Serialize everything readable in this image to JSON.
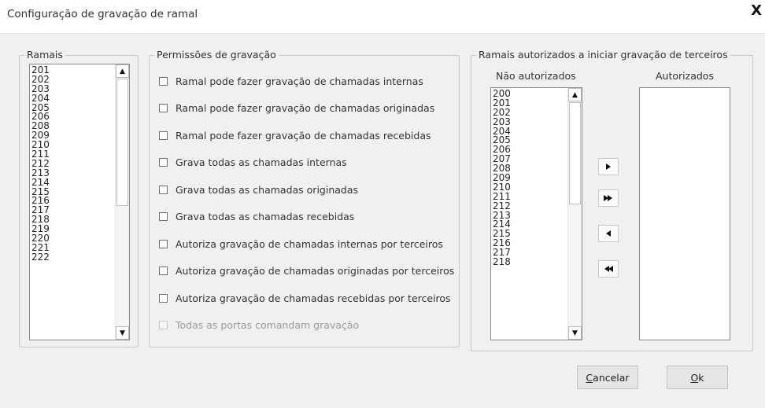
{
  "window": {
    "title": "Configuração de gravação de ramal",
    "close_label": "X"
  },
  "ramais": {
    "legend": "Ramais",
    "items": [
      "201",
      "202",
      "203",
      "204",
      "205",
      "206",
      "208",
      "209",
      "210",
      "211",
      "212",
      "213",
      "214",
      "215",
      "216",
      "217",
      "218",
      "219",
      "220",
      "221",
      "222"
    ]
  },
  "permissoes": {
    "legend": "Permissões de gravação",
    "options": [
      {
        "label": "Ramal pode fazer gravação de chamadas internas",
        "checked": false,
        "enabled": true
      },
      {
        "label": "Ramal pode fazer gravação de chamadas originadas",
        "checked": false,
        "enabled": true
      },
      {
        "label": "Ramal pode fazer gravação de chamadas recebidas",
        "checked": false,
        "enabled": true
      },
      {
        "label": "Grava todas as chamadas internas",
        "checked": false,
        "enabled": true
      },
      {
        "label": "Grava todas as chamadas originadas",
        "checked": false,
        "enabled": true
      },
      {
        "label": "Grava todas as chamadas recebidas",
        "checked": false,
        "enabled": true
      },
      {
        "label": "Autoriza gravação de chamadas internas por terceiros",
        "checked": false,
        "enabled": true
      },
      {
        "label": "Autoriza gravação de chamadas originadas por terceiros",
        "checked": false,
        "enabled": true
      },
      {
        "label": "Autoriza gravação de chamadas recebidas por terceiros",
        "checked": false,
        "enabled": true
      },
      {
        "label": "Todas as portas comandam gravação",
        "checked": false,
        "enabled": false
      }
    ]
  },
  "terceiros": {
    "legend": "Ramais autorizados a iniciar gravação de terceiros",
    "nao_autorizados_label": "Não autorizados",
    "autorizados_label": "Autorizados",
    "nao_autorizados": [
      "200",
      "201",
      "202",
      "203",
      "204",
      "205",
      "206",
      "207",
      "208",
      "209",
      "210",
      "211",
      "212",
      "213",
      "214",
      "215",
      "216",
      "217",
      "218"
    ],
    "autorizados": []
  },
  "buttons": {
    "cancel_mnemonic": "C",
    "cancel_rest": "ancelar",
    "ok_mnemonic": "O",
    "ok_rest": "k"
  },
  "icons": {
    "move_right": "triangle-right-icon",
    "move_all_right": "double-triangle-right-icon",
    "move_left": "triangle-left-icon",
    "move_all_left": "double-triangle-left-icon"
  }
}
